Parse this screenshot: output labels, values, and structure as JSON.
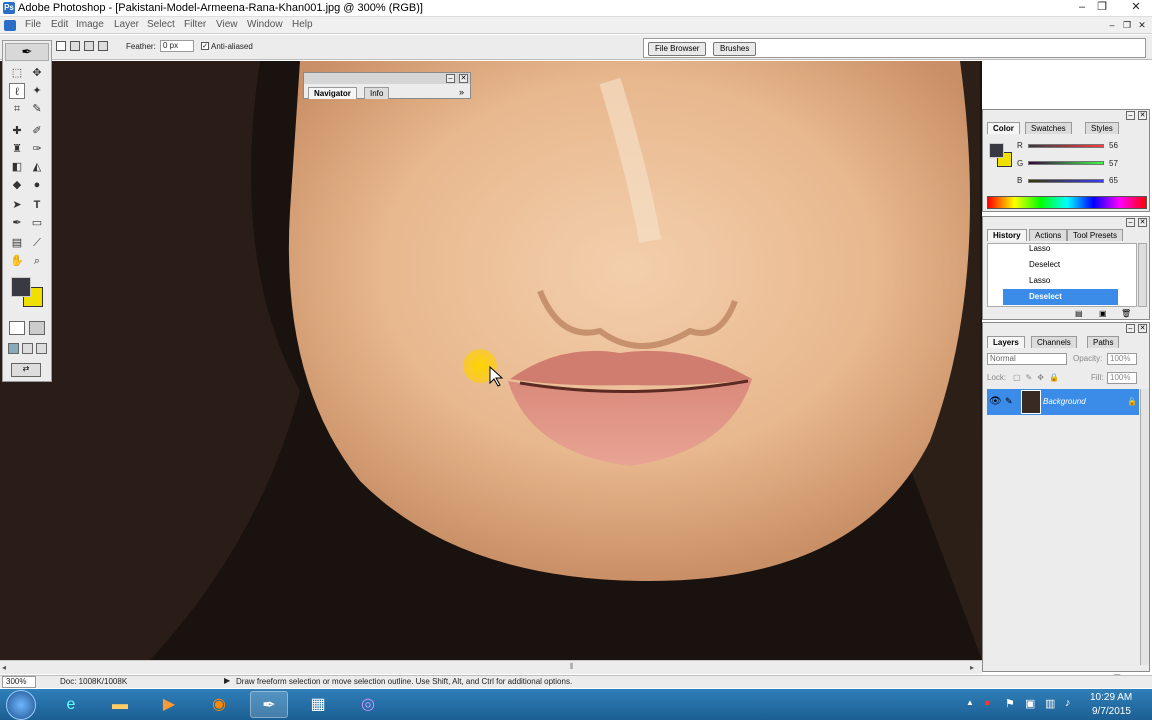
{
  "window": {
    "title": "Adobe Photoshop - [Pakistani-Model-Armeena-Rana-Khan001.jpg @ 300% (RGB)]",
    "minimize": "–",
    "restore": "❐",
    "close": "✕",
    "doc_minimize": "–",
    "doc_restore": "❐",
    "doc_close": "✕"
  },
  "menu": [
    "File",
    "Edit",
    "Image",
    "Layer",
    "Select",
    "Filter",
    "View",
    "Window",
    "Help"
  ],
  "options": {
    "feather_label": "Feather:",
    "feather_value": "0 px",
    "antialias_label": "Anti-aliased",
    "antialias_check": "✓"
  },
  "palette_well": {
    "file_browser": "File Browser",
    "brushes": "Brushes"
  },
  "navigator": {
    "tabs": [
      "Navigator",
      "Info"
    ],
    "arrow": "»",
    "close": "✕",
    "min": "–"
  },
  "color": {
    "tabs": [
      "Color",
      "Swatches",
      "Styles"
    ],
    "r_label": "R",
    "r": "56",
    "g_label": "G",
    "g": "57",
    "b_label": "B",
    "b": "65",
    "fg": "#383941",
    "bg": "#f0e000"
  },
  "history": {
    "tabs": [
      "History",
      "Actions",
      "Tool Presets"
    ],
    "items": [
      "Lasso",
      "Deselect",
      "Lasso",
      "Deselect"
    ]
  },
  "layers": {
    "tabs": [
      "Layers",
      "Channels",
      "Paths"
    ],
    "blend": "Normal",
    "opacity_label": "Opacity:",
    "opacity": "100%",
    "lock_label": "Lock:",
    "fill_label": "Fill:",
    "fill": "100%",
    "layer_name": "Background"
  },
  "status": {
    "zoom": "300%",
    "doc": "Doc: 1008K/1008K",
    "hint": "Draw freeform selection or move selection outline.  Use Shift, Alt, and Ctrl for additional options."
  },
  "taskbar": {
    "time": "10:29 AM",
    "date": "9/7/2015",
    "tray_arrow": "▲"
  },
  "accent_colors": {
    "title_icon": "#2a6ec8",
    "selection": "#3a8ce8",
    "taskbar": "#1c5f94"
  }
}
